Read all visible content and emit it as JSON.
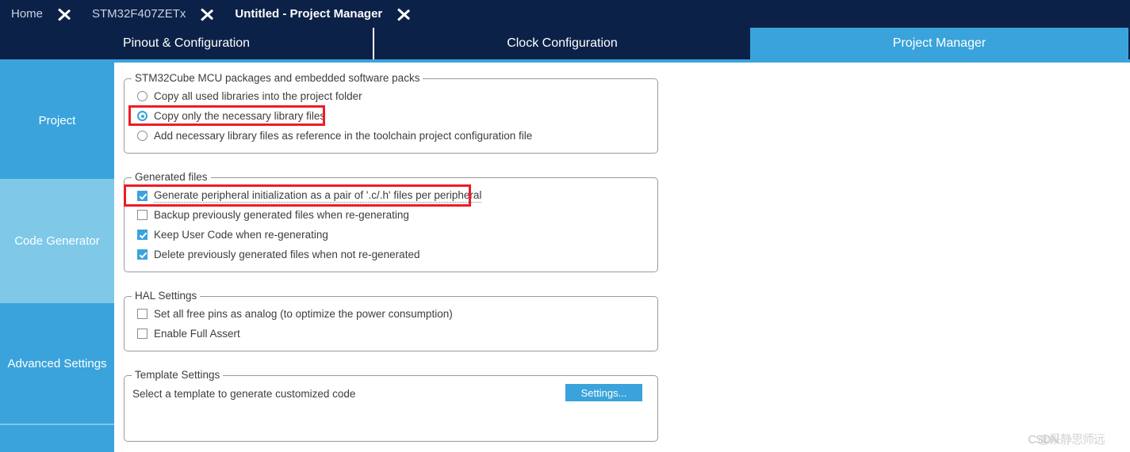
{
  "breadcrumb": {
    "items": [
      {
        "label": "Home",
        "active": false
      },
      {
        "label": "STM32F407ZETx",
        "active": false
      },
      {
        "label": "Untitled - Project Manager",
        "active": true
      }
    ]
  },
  "tabs": [
    {
      "label": "Pinout & Configuration",
      "selected": false
    },
    {
      "label": "Clock Configuration",
      "selected": false
    },
    {
      "label": "Project Manager",
      "selected": true
    }
  ],
  "sidebar": {
    "items": [
      {
        "label": "Project",
        "selected": false
      },
      {
        "label": "Code Generator",
        "selected": true
      },
      {
        "label": "Advanced Settings",
        "selected": false
      },
      {
        "label": "",
        "selected": false
      }
    ]
  },
  "groups": {
    "packages": {
      "title": "STM32Cube MCU packages and embedded software packs",
      "options": [
        {
          "label": "Copy all used libraries into the project folder",
          "checked": false
        },
        {
          "label": "Copy only the necessary library files",
          "checked": true,
          "highlighted": true
        },
        {
          "label": "Add necessary library files as reference in the toolchain project configuration file",
          "checked": false
        }
      ]
    },
    "generated_files": {
      "title": "Generated files",
      "options": [
        {
          "label": "Generate peripheral initialization as a pair of '.c/.h' files per peripheral",
          "checked": true,
          "highlighted": true,
          "focused": true
        },
        {
          "label": "Backup previously generated files when re-generating",
          "checked": false
        },
        {
          "label": "Keep User Code when re-generating",
          "checked": true
        },
        {
          "label": "Delete previously generated files when not re-generated",
          "checked": true
        }
      ]
    },
    "hal_settings": {
      "title": "HAL Settings",
      "options": [
        {
          "label": "Set all free pins as analog (to optimize the power consumption)",
          "checked": false
        },
        {
          "label": "Enable Full Assert",
          "checked": false
        }
      ]
    },
    "template_settings": {
      "title": "Template Settings",
      "description": "Select a template to generate customized code",
      "button_label": "Settings..."
    }
  },
  "watermark": {
    "front": "CSDN",
    "back": "@采静思师远"
  },
  "colors": {
    "navy": "#0b2147",
    "accent_blue": "#3aa3db",
    "light_blue": "#7fc8e8",
    "annotation_red": "#ee1c25",
    "text": "#3d3d3d"
  }
}
